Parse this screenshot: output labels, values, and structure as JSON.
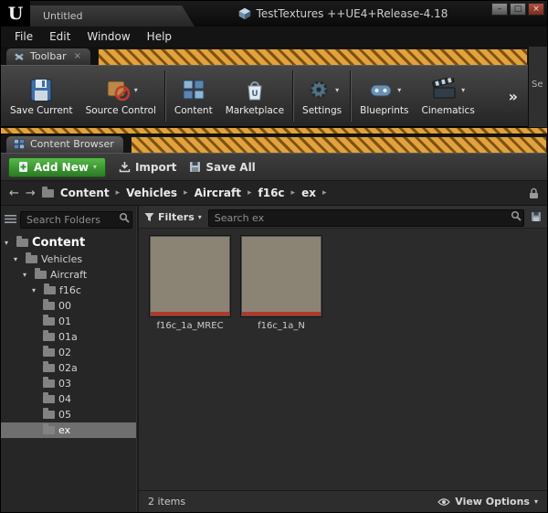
{
  "window": {
    "logo": "U",
    "tab_title": "Untitled",
    "title": "TestTextures ++UE4+Release-4.18",
    "controls": {
      "minimize": "–",
      "maximize": "□",
      "close": "×"
    }
  },
  "menu": {
    "items": [
      {
        "label": "File"
      },
      {
        "label": "Edit"
      },
      {
        "label": "Window"
      },
      {
        "label": "Help"
      }
    ]
  },
  "toolbar_tab": {
    "label": "Toolbar",
    "close": "×"
  },
  "toolbar": {
    "overflow": "»",
    "side_panel_label": "Se",
    "buttons": [
      {
        "label": "Save Current"
      },
      {
        "label": "Source Control",
        "dropdown": "▾"
      },
      {
        "label": "Content"
      },
      {
        "label": "Marketplace"
      },
      {
        "label": "Settings",
        "dropdown": "▾"
      },
      {
        "label": "Blueprints",
        "dropdown": "▾"
      },
      {
        "label": "Cinematics",
        "dropdown": "▾"
      }
    ]
  },
  "content_browser": {
    "tab_label": "Content Browser",
    "actions": {
      "add_new": "Add New",
      "import": "Import",
      "save_all": "Save All",
      "dropdown": "▾"
    },
    "nav": {
      "back": "←",
      "forward": "→"
    },
    "breadcrumbs": [
      {
        "label": "Content"
      },
      {
        "label": "Vehicles"
      },
      {
        "label": "Aircraft"
      },
      {
        "label": "f16c"
      },
      {
        "label": "ex"
      }
    ],
    "crumb_sep": "▸",
    "folders_search_placeholder": "Search Folders",
    "filters_label": "Filters",
    "filters_dropdown": "▾",
    "search_placeholder": "Search ex",
    "status": {
      "items_count": "2 items",
      "view_options": "View Options",
      "dropdown": "▾"
    }
  },
  "tree": {
    "expander": "▾",
    "items": [
      {
        "label": "Content"
      },
      {
        "label": "Vehicles"
      },
      {
        "label": "Aircraft"
      },
      {
        "label": "f16c"
      },
      {
        "label": "00"
      },
      {
        "label": "01"
      },
      {
        "label": "01a"
      },
      {
        "label": "02"
      },
      {
        "label": "02a"
      },
      {
        "label": "03"
      },
      {
        "label": "04"
      },
      {
        "label": "05"
      },
      {
        "label": "ex"
      }
    ]
  },
  "assets": {
    "items": [
      {
        "name": "f16c_1a_MREC"
      },
      {
        "name": "f16c_1a_N"
      }
    ]
  },
  "colors": {
    "stripe_orange": "#e2a23c",
    "stripe_dark": "#7d5212",
    "addnew_green": "#3e9e33",
    "selection": "#6f6f6f",
    "thumb_tan": "#8b8474",
    "thumb_stripe": "#b5372b"
  }
}
